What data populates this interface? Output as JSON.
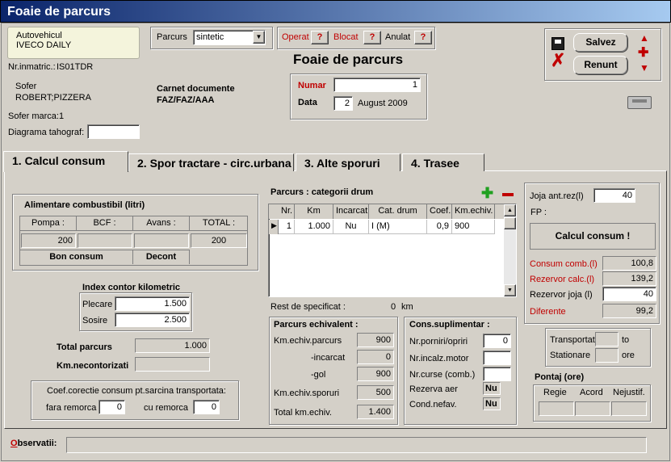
{
  "window": {
    "title": "Foaie de parcurs"
  },
  "vehicle": {
    "label": "Autovehicul",
    "name": "IVECO DAILY",
    "nr_label": "Nr.inmatric.:",
    "nr_value": "IS01TDR"
  },
  "parcurs": {
    "label": "Parcurs",
    "value": "sintetic"
  },
  "flags": {
    "operat": "Operat",
    "blocat": "Blocat",
    "anulat": "Anulat",
    "q": "?"
  },
  "form_title": "Foaie de parcurs",
  "driver": {
    "label": "Sofer",
    "name": "ROBERT;PIZZERA",
    "marca_label": "Sofer marca:",
    "marca_value": "1"
  },
  "carnet": {
    "label": "Carnet documente",
    "value": "FAZ/FAZ/AAA"
  },
  "numar": {
    "label": "Numar",
    "value": "1"
  },
  "data": {
    "label": "Data",
    "day": "2",
    "month": "August 2009"
  },
  "tahograf": {
    "label": "Diagrama tahograf:",
    "value": ""
  },
  "actions": {
    "save": "Salvez",
    "cancel": "Renunt"
  },
  "tabs": [
    "1. Calcul consum",
    "2. Spor tractare - circ.urbana",
    "3. Alte sporuri",
    "4. Trasee"
  ],
  "alimentare": {
    "title": "Alimentare combustibil (litri)",
    "headers": [
      "Pompa :",
      "BCF :",
      "Avans :",
      "TOTAL :"
    ],
    "values": [
      "200",
      "",
      "",
      "200"
    ],
    "bon": "Bon consum",
    "decont": "Decont"
  },
  "index": {
    "title": "Index contor kilometric",
    "plecare_label": "Plecare",
    "plecare": "1.500",
    "sosire_label": "Sosire",
    "sosire": "2.500"
  },
  "total_parcurs": {
    "label": "Total parcurs",
    "value": "1.000"
  },
  "km_necontorizati": {
    "label": "Km.necontorizati",
    "value": ""
  },
  "coef": {
    "title": "Coef.corectie consum pt.sarcina transportata:",
    "fara_label": "fara remorca",
    "fara": "0",
    "cu_label": "cu remorca",
    "cu": "0"
  },
  "categorii": {
    "title": "Parcurs : categorii drum",
    "headers": [
      "Nr.",
      "Km",
      "Incarcat",
      "Cat. drum",
      "Coef.",
      "Km.echiv."
    ],
    "rows": [
      {
        "nr": "1",
        "km": "1.000",
        "incarcat": "Nu",
        "cat": "I (M)",
        "coef": "0,9",
        "echiv": "900"
      }
    ]
  },
  "rest": {
    "label": "Rest de specificat :",
    "value": "0",
    "unit": "km"
  },
  "echivalent": {
    "title": "Parcurs echivalent :",
    "parcurs_label": "Km.echiv.parcurs",
    "parcurs": "900",
    "incarcat_label": "-incarcat",
    "incarcat": "0",
    "gol_label": "-gol",
    "gol": "900",
    "sporuri_label": "Km.echiv.sporuri",
    "sporuri": "500",
    "total_label": "Total km.echiv.",
    "total": "1.400"
  },
  "cons": {
    "title": "Cons.suplimentar :",
    "pornire_label": "Nr.porniri/opriri",
    "pornire": "0",
    "incalz_label": "Nr.incalz.motor",
    "incalz": "",
    "curse_label": "Nr.curse (comb.)",
    "curse": "",
    "rezerva_label": "Rezerva aer",
    "rezerva": "Nu",
    "cond_label": "Cond.nefav.",
    "cond": "Nu"
  },
  "right": {
    "joja_label": "Joja ant.rez(l)",
    "joja": "40",
    "fp_label": "FP :",
    "calcul_btn": "Calcul consum !",
    "consum_label": "Consum comb.(l)",
    "consum": "100,8",
    "rezcalc_label": "Rezervor calc.(l)",
    "rezcalc": "139,2",
    "rezjoja_label": "Rezervor joja (l)",
    "rezjoja": "40",
    "diferente_label": "Diferente",
    "diferente": "99,2"
  },
  "transport": {
    "transportat_label": "Transportat",
    "transportat_unit": "to",
    "stationare_label": "Stationare",
    "stationare_unit": "ore"
  },
  "pontaj": {
    "title": "Pontaj (ore)",
    "headers": [
      "Regie",
      "Acord",
      "Nejustif."
    ]
  },
  "observatii": {
    "label": "Observatii:",
    "value": ""
  },
  "colors": {
    "title_start": "#0a246a",
    "title_end": "#a6caf0",
    "red": "#c00000",
    "green": "#20a020"
  }
}
